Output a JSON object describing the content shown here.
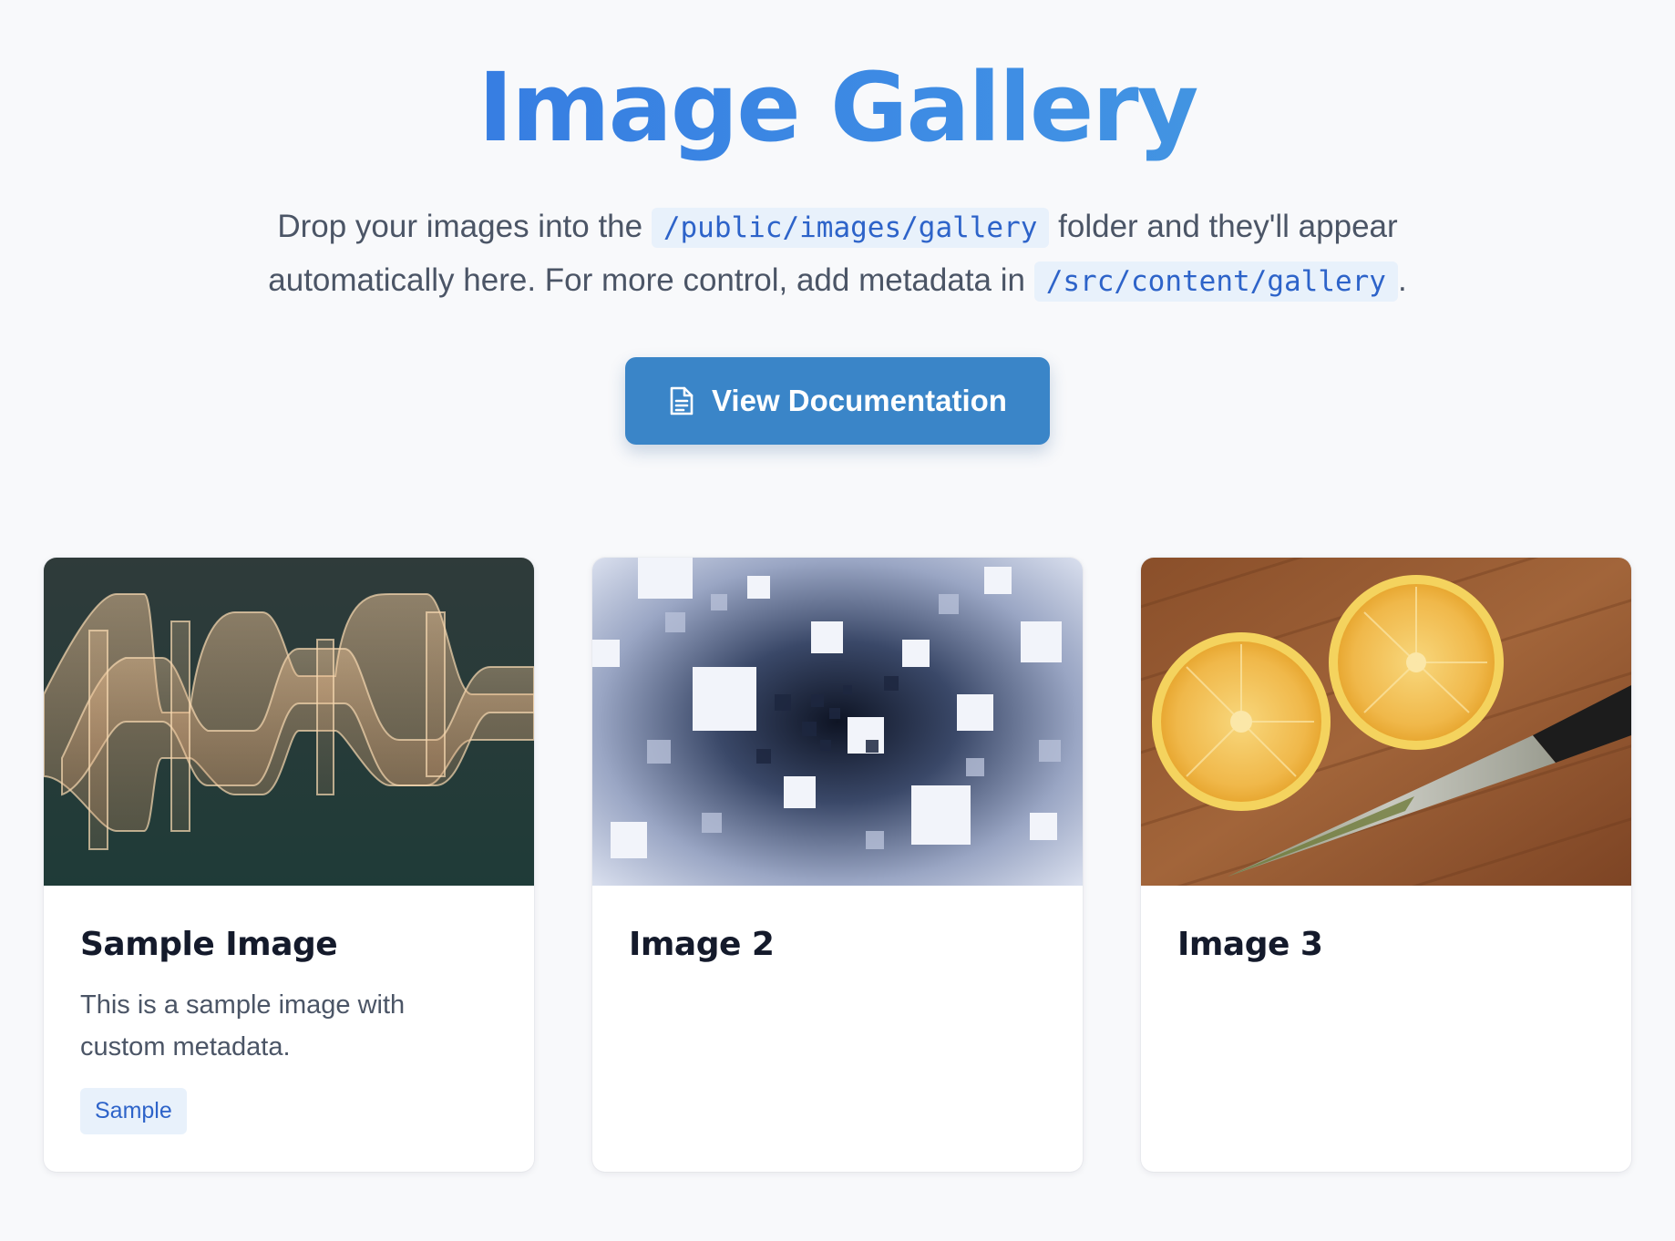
{
  "header": {
    "title": "Image Gallery",
    "intro_before": "Drop your images into the ",
    "path_public": "/public/images/gallery",
    "intro_middle": " folder and they'll appear automatically here. For more control, add metadata in ",
    "path_content": "/src/content/gallery",
    "intro_end": "."
  },
  "doc_button": {
    "label": "View Documentation",
    "icon": "document-icon"
  },
  "colors": {
    "accent": "#3a85c8",
    "title_gradient_start": "#2f6fe0",
    "title_gradient_end": "#4aa3de",
    "tag_bg": "#e8f1fb",
    "background": "#f8f9fb"
  },
  "gallery": {
    "cards": [
      {
        "title": "Sample Image",
        "description": "This is a sample image with custom metadata.",
        "tag": "Sample",
        "image": "abstract-translucent-ribbons"
      },
      {
        "title": "Image 2",
        "image": "blue-cube-tunnel"
      },
      {
        "title": "Image 3",
        "image": "lemon-halves-with-knife"
      }
    ]
  }
}
